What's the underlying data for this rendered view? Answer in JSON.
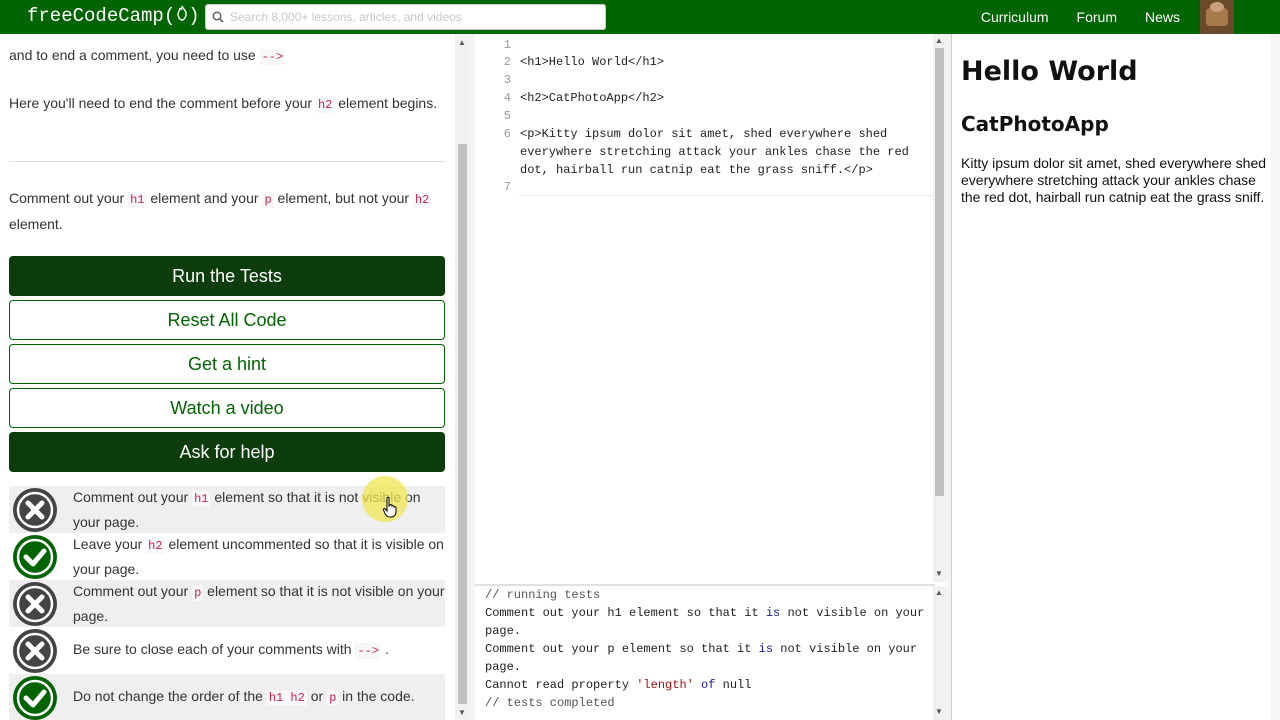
{
  "nav": {
    "logo": "freeCodeCamp(🔥)",
    "logo_text": "freeCodeCamp(",
    "logo_end": ")",
    "search_placeholder": "Search 8,000+ lessons, articles, and videos",
    "links": [
      "Curriculum",
      "Forum",
      "News"
    ]
  },
  "instructions": {
    "p1_a": "and to end a comment, you need to use ",
    "p1_code": "-->",
    "p2_a": "Here you'll need to end the comment before your ",
    "p2_code": "h2",
    "p2_b": " element begins.",
    "p3_a": "Comment out your ",
    "p3_code1": "h1",
    "p3_b": " element and your ",
    "p3_code2": "p",
    "p3_c": " element, but not your ",
    "p3_code3": "h2",
    "p3_d": " element."
  },
  "buttons": {
    "run_tests": "Run the Tests",
    "reset": "Reset All Code",
    "hint": "Get a hint",
    "video": "Watch a video",
    "help": "Ask for help"
  },
  "tests": [
    {
      "status": "fail",
      "a": "Comment out your ",
      "code": "h1",
      "b": " element so that it is not visible on your page."
    },
    {
      "status": "pass",
      "a": "Leave your ",
      "code": "h2",
      "b": " element uncommented so that it is visible on your page."
    },
    {
      "status": "fail",
      "a": "Comment out your ",
      "code": "p",
      "b": " element so that it is not visible on your page."
    },
    {
      "status": "fail",
      "a": "Be sure to close each of your comments with ",
      "code": "-->",
      "b": " ."
    },
    {
      "status": "pass",
      "a": "Do not change the order of the ",
      "code": "h1 h2",
      "b": " or ",
      "code2": "p",
      "c": " in the code."
    }
  ],
  "editor": {
    "lines": [
      {
        "n": "1",
        "text": ""
      },
      {
        "n": "2",
        "text": "<h1>Hello World</h1>"
      },
      {
        "n": "3",
        "text": ""
      },
      {
        "n": "4",
        "text": "<h2>CatPhotoApp</h2>"
      },
      {
        "n": "5",
        "text": ""
      },
      {
        "n": "6",
        "text": "<p>Kitty ipsum dolor sit amet, shed everywhere shed"
      },
      {
        "n": "",
        "text": "everywhere stretching attack your ankles chase the red"
      },
      {
        "n": "",
        "text": "dot, hairball run catnip eat the grass sniff.</p>"
      },
      {
        "n": "7",
        "text": ""
      }
    ]
  },
  "console": {
    "line1": "// running tests",
    "line2a": "Comment out your h1 element so that it ",
    "line2kw": "is",
    "line2b": " not visible on your",
    "line3": "page.",
    "line4a": "Comment out your p element so that it ",
    "line4kw": "is",
    "line4b": " not visible on your",
    "line5": "page.",
    "line6a": "Cannot read property ",
    "line6str": "'length'",
    "line6kw": "of",
    "line6b": " null",
    "line7": "// tests completed"
  },
  "preview": {
    "h1": "Hello World",
    "h2": "CatPhotoApp",
    "p": "Kitty ipsum dolor sit amet, shed everywhere shed everywhere stretching attack your ankles chase the red dot, hairball run catnip eat the grass sniff."
  },
  "colors": {
    "brand_green": "#006400",
    "dark_button": "#0d3d0d",
    "fail_badge": "#444444"
  }
}
